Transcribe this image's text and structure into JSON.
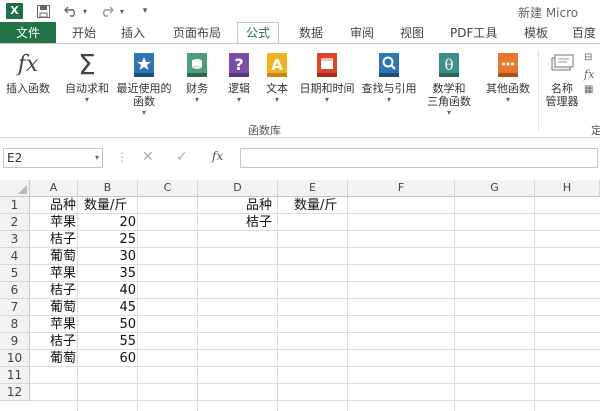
{
  "window": {
    "logo": "X",
    "title": "新建 Micro"
  },
  "tabs": {
    "file": "文件",
    "items": [
      "开始",
      "插入",
      "页面布局",
      "公式",
      "数据",
      "审阅",
      "视图",
      "PDF工具",
      "模板",
      "百度"
    ],
    "active": "公式"
  },
  "ribbon": {
    "buttons": [
      {
        "label": "插入函数",
        "icon": "fx-icon"
      },
      {
        "label": "自动求和",
        "icon": "sigma-icon"
      },
      {
        "label": "最近使用的函数",
        "icon": "star-book-icon"
      },
      {
        "label": "财务",
        "icon": "finance-book-icon"
      },
      {
        "label": "逻辑",
        "icon": "logic-book-icon"
      },
      {
        "label": "文本",
        "icon": "text-book-icon"
      },
      {
        "label": "日期和时间",
        "icon": "calendar-book-icon"
      },
      {
        "label": "查找与引用",
        "icon": "lookup-book-icon"
      },
      {
        "label": "数学和三角函数",
        "icon": "math-book-icon"
      },
      {
        "label": "其他函数",
        "icon": "more-book-icon"
      },
      {
        "label": "名称管理器",
        "icon": "name-manager-icon"
      }
    ],
    "labels": {
      "insert_fn": "插入函数",
      "autosum": "自动求和",
      "recent_1": "最近使用的",
      "recent_2": "函数",
      "finance": "财务",
      "logic": "逻辑",
      "text": "文本",
      "datetime": "日期和时间",
      "lookup": "查找与引用",
      "math_1": "数学和",
      "math_2": "三角函数",
      "other": "其他函数",
      "name_1": "名称",
      "name_2": "管理器",
      "define": "定"
    },
    "group_label": "函数库"
  },
  "formula_bar": {
    "name_box": "E2",
    "fx": "fx",
    "value": ""
  },
  "sheet": {
    "columns": [
      "A",
      "B",
      "C",
      "D",
      "E",
      "F",
      "G",
      "H"
    ],
    "rows": [
      "1",
      "2",
      "3",
      "4",
      "5",
      "6",
      "7",
      "8",
      "9",
      "10",
      "11",
      "12"
    ],
    "cells": {
      "A1": "品种",
      "B1": "数量/斤",
      "A2": "苹果",
      "B2": "20",
      "A3": "桔子",
      "B3": "25",
      "A4": "葡萄",
      "B4": "30",
      "A5": "苹果",
      "B5": "35",
      "A6": "桔子",
      "B6": "40",
      "A7": "葡萄",
      "B7": "45",
      "A8": "苹果",
      "B8": "50",
      "A9": "桔子",
      "B9": "55",
      "A10": "葡萄",
      "B10": "60",
      "D1": "品种",
      "E1": "数量/斤",
      "D2": "桔子"
    }
  }
}
